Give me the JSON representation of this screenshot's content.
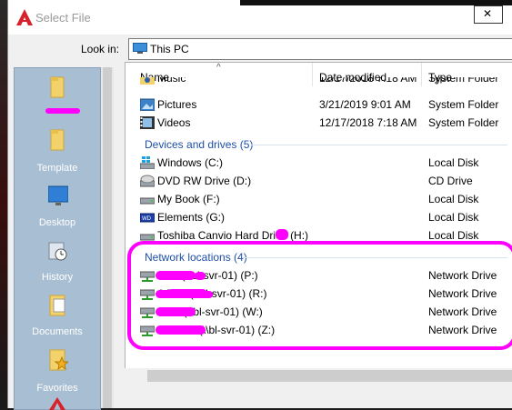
{
  "window": {
    "title": "Select File"
  },
  "toolbar": {
    "look_in_label": "Look in:",
    "look_in_value": "This PC"
  },
  "places": [
    {
      "label": "",
      "icon": "folder-icon"
    },
    {
      "label": "Template",
      "icon": "folder-icon"
    },
    {
      "label": "Desktop",
      "icon": "desktop-icon"
    },
    {
      "label": "History",
      "icon": "history-icon"
    },
    {
      "label": "Documents",
      "icon": "documents-icon"
    },
    {
      "label": "Favorites",
      "icon": "favorites-icon"
    }
  ],
  "columns": {
    "name": "Name",
    "date": "Date modified",
    "type": "Type"
  },
  "rows_top": [
    {
      "name": "Music",
      "date": "12/17/2018 7:18 AM",
      "type": "System Folder",
      "icon": "music-folder-icon"
    },
    {
      "name": "Pictures",
      "date": "3/21/2019 9:01 AM",
      "type": "System Folder",
      "icon": "pictures-folder-icon"
    },
    {
      "name": "Videos",
      "date": "12/17/2018 7:18 AM",
      "type": "System Folder",
      "icon": "videos-folder-icon"
    }
  ],
  "groups": {
    "devices": "Devices and drives (5)",
    "network": "Network locations (4)"
  },
  "drives": [
    {
      "name": "Windows (C:)",
      "type": "Local Disk",
      "icon": "windows-drive-icon"
    },
    {
      "name": "DVD RW Drive (D:)",
      "type": "CD Drive",
      "icon": "dvd-drive-icon"
    },
    {
      "name": "My Book (F:)",
      "type": "Local Disk",
      "icon": "drive-icon"
    },
    {
      "name": "Elements (G:)",
      "type": "Local Disk",
      "icon": "wd-drive-icon"
    },
    {
      "name": "Toshiba Canvio Hard Drive (H:)",
      "type": "Local Disk",
      "icon": "drive-icon"
    }
  ],
  "network": [
    {
      "name": "PHII (\\\\bl-svr-01) (P:)",
      "type": "Network Drive",
      "icon": "network-drive-icon"
    },
    {
      "name": "ACCT (\\\\bl-svr-01) (R:)",
      "type": "Network Drive",
      "icon": "network-drive-icon"
    },
    {
      "name": "CAD (\\\\bl-svr-01) (W:)",
      "type": "Network Drive",
      "icon": "network-drive-icon"
    },
    {
      "name": "PHOTO (\\\\bl-svr-01) (Z:)",
      "type": "Network Drive",
      "icon": "network-drive-icon"
    }
  ],
  "colors": {
    "group_title": "#1e4fa8",
    "highlight": "#ff00ff",
    "places_bg": "#a8bed2"
  }
}
